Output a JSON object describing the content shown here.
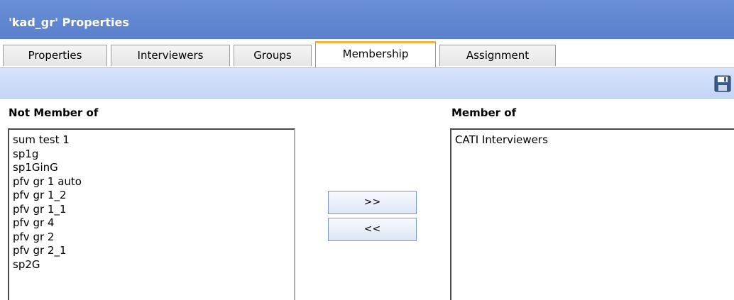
{
  "window": {
    "title": "'kad_gr' Properties"
  },
  "tabs": [
    {
      "label": "Properties",
      "active": false
    },
    {
      "label": "Interviewers",
      "active": false
    },
    {
      "label": "Groups",
      "active": false
    },
    {
      "label": "Membership",
      "active": true
    },
    {
      "label": "Assignment",
      "active": false
    }
  ],
  "toolbar": {
    "save_icon": "floppy-disk-save-icon"
  },
  "membership": {
    "not_member_label": "Not Member of",
    "member_label": "Member of",
    "not_member_items": [
      "sum test 1",
      "sp1g",
      "sp1GinG",
      "pfv gr 1 auto",
      "pfv gr 1_2",
      "pfv gr 1_1",
      "pfv gr 4",
      "pfv gr 2",
      "pfv gr 2_1",
      "sp2G"
    ],
    "member_items": [
      "CATI Interviewers"
    ],
    "add_label": ">>",
    "remove_label": "<<"
  },
  "colors": {
    "title_bar": "#5a80cc",
    "toolbar": "#c9daf8",
    "active_tab_accent": "#f2b540"
  }
}
